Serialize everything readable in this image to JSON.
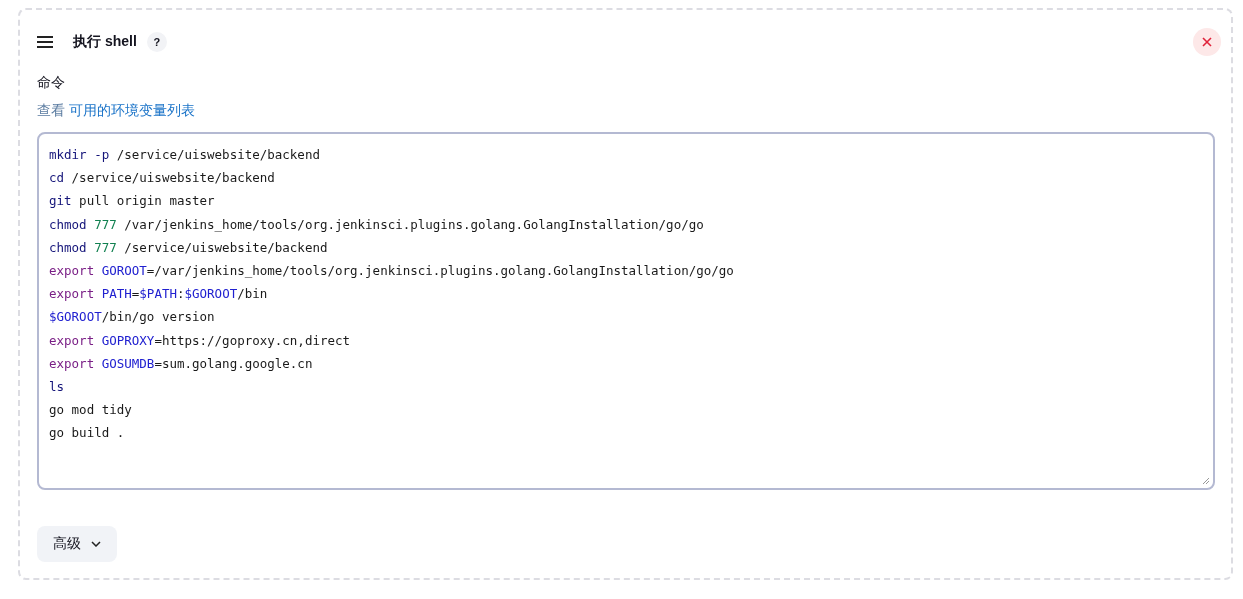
{
  "section": {
    "title": "执行 shell",
    "help": "?"
  },
  "command": {
    "label": "命令",
    "link_prefix": "查看",
    "link": "可用的环境变量列表",
    "lines": [
      [
        {
          "kind": "cmd",
          "text": "mkdir"
        },
        {
          "kind": "cmd",
          "text": " -p"
        },
        {
          "kind": "plain",
          "text": " /service/uiswebsite/backend"
        }
      ],
      [
        {
          "kind": "cmd",
          "text": "cd"
        },
        {
          "kind": "plain",
          "text": " /service/uiswebsite/backend"
        }
      ],
      [
        {
          "kind": "cmd",
          "text": "git"
        },
        {
          "kind": "plain",
          "text": " pull origin master"
        }
      ],
      [
        {
          "kind": "cmd",
          "text": "chmod"
        },
        {
          "kind": "number",
          "text": " 777"
        },
        {
          "kind": "plain",
          "text": " /var/jenkins_home/tools/org.jenkinsci.plugins.golang.GolangInstallation/go/go"
        }
      ],
      [
        {
          "kind": "cmd",
          "text": "chmod"
        },
        {
          "kind": "number",
          "text": " 777"
        },
        {
          "kind": "plain",
          "text": " /service/uiswebsite/backend"
        }
      ],
      [
        {
          "kind": "keyword",
          "text": "export"
        },
        {
          "kind": "var",
          "text": " GOROOT"
        },
        {
          "kind": "plain",
          "text": "=/var/jenkins_home/tools/org.jenkinsci.plugins.golang.GolangInstallation/go/go"
        }
      ],
      [
        {
          "kind": "keyword",
          "text": "export"
        },
        {
          "kind": "var",
          "text": " PATH"
        },
        {
          "kind": "plain",
          "text": "="
        },
        {
          "kind": "var",
          "text": "$PATH"
        },
        {
          "kind": "plain",
          "text": ":"
        },
        {
          "kind": "var",
          "text": "$GOROOT"
        },
        {
          "kind": "plain",
          "text": "/bin"
        }
      ],
      [
        {
          "kind": "var",
          "text": "$GOROOT"
        },
        {
          "kind": "plain",
          "text": "/bin/go version"
        }
      ],
      [
        {
          "kind": "keyword",
          "text": "export"
        },
        {
          "kind": "var",
          "text": " GOPROXY"
        },
        {
          "kind": "plain",
          "text": "=https://goproxy.cn,direct"
        }
      ],
      [
        {
          "kind": "keyword",
          "text": "export"
        },
        {
          "kind": "var",
          "text": " GOSUMDB"
        },
        {
          "kind": "plain",
          "text": "=sum.golang.google.cn"
        }
      ],
      [
        {
          "kind": "cmd",
          "text": "ls"
        }
      ],
      [
        {
          "kind": "plain",
          "text": "go mod tidy"
        }
      ],
      [
        {
          "kind": "plain",
          "text": "go build ."
        }
      ]
    ]
  },
  "advanced": {
    "label": "高级",
    "expanded": false
  }
}
